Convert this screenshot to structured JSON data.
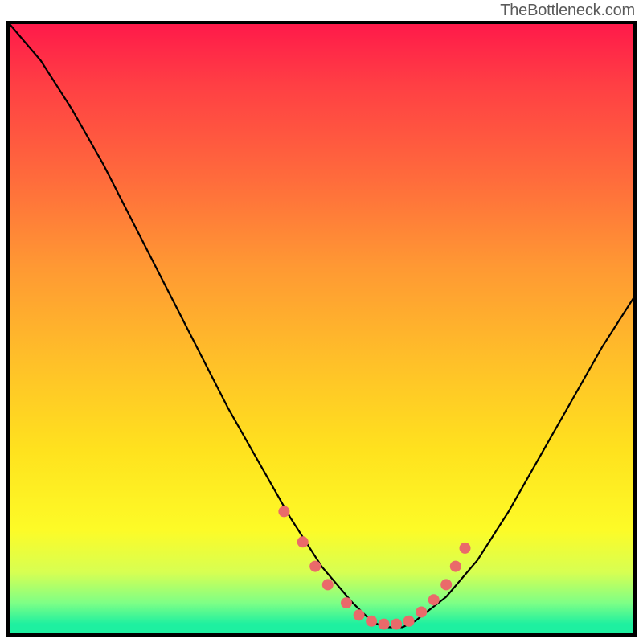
{
  "watermark": "TheBottleneck.com",
  "chart_data": {
    "type": "line",
    "title": "",
    "xlabel": "",
    "ylabel": "",
    "xlim": [
      0,
      100
    ],
    "ylim": [
      0,
      100
    ],
    "series": [
      {
        "name": "curve",
        "x": [
          0,
          5,
          10,
          15,
          20,
          25,
          30,
          35,
          40,
          45,
          50,
          55,
          58,
          60,
          63,
          65,
          70,
          75,
          80,
          85,
          90,
          95,
          100
        ],
        "values": [
          100,
          94,
          86,
          77,
          67,
          57,
          47,
          37,
          28,
          19,
          11,
          5,
          2,
          1,
          1,
          2,
          6,
          12,
          20,
          29,
          38,
          47,
          55
        ]
      }
    ],
    "markers": {
      "name": "highlight-dots",
      "color": "#ea6a6a",
      "x": [
        44,
        47,
        49,
        51,
        54,
        56,
        58,
        60,
        62,
        64,
        66,
        68,
        70,
        71.5,
        73
      ],
      "values": [
        20,
        15,
        11,
        8,
        5,
        3,
        2,
        1.5,
        1.5,
        2,
        3.5,
        5.5,
        8,
        11,
        14
      ]
    },
    "gradient_stops": [
      {
        "pos": 0.0,
        "color": "#ff1a4a"
      },
      {
        "pos": 0.4,
        "color": "#ff9933"
      },
      {
        "pos": 0.75,
        "color": "#ffe21e"
      },
      {
        "pos": 0.92,
        "color": "#d7ff52"
      },
      {
        "pos": 1.0,
        "color": "#1ef0a0"
      }
    ]
  }
}
